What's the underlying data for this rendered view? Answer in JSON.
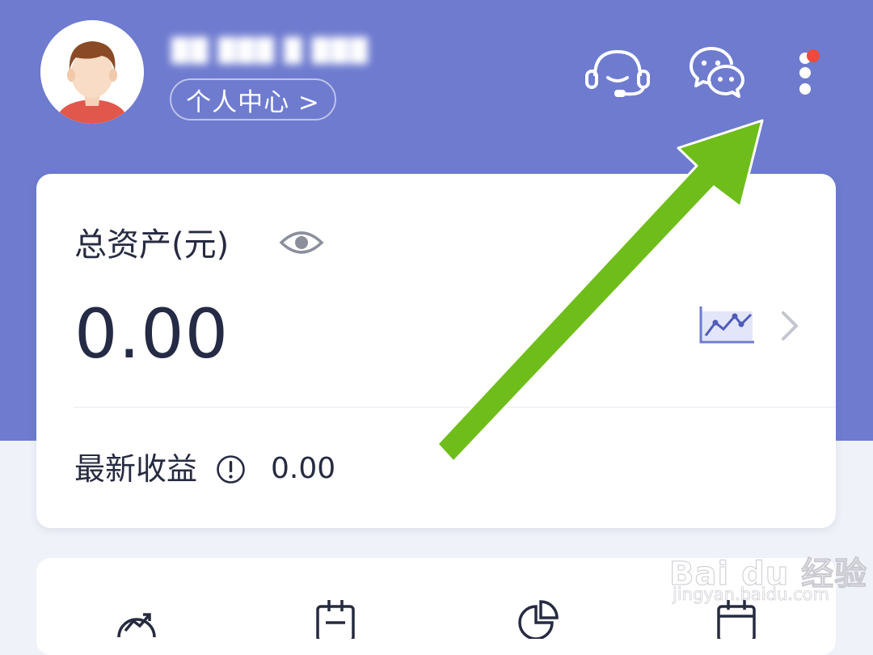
{
  "header": {
    "username": "██ ███ █ ███",
    "profile_link": "个人中心 >",
    "icons": [
      "customer-service-icon",
      "wechat-icon",
      "more-icon"
    ],
    "notification_dot_color": "#f04a3c"
  },
  "assets_card": {
    "label": "总资产(元)",
    "value": "0.00",
    "earnings_label": "最新收益",
    "earnings_value": "0.00"
  },
  "colors": {
    "header_bg": "#6e7bcf",
    "arrow": "#6fbd1a",
    "text": "#262b40"
  },
  "watermark": {
    "brand": "Bai du 经验",
    "url": "jingyan.baidu.com"
  }
}
